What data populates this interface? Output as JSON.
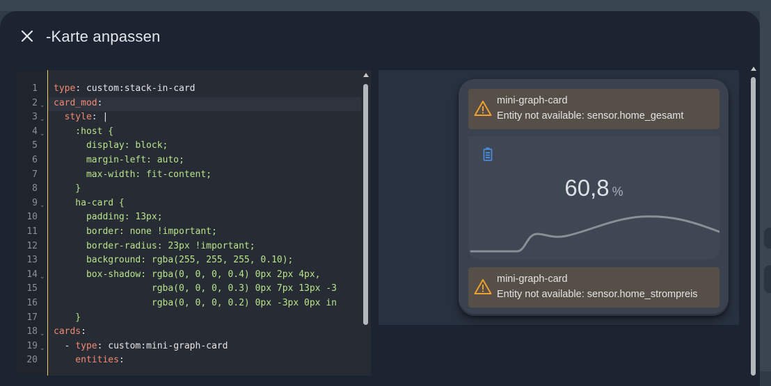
{
  "dialog": {
    "title": "-Karte anpassen"
  },
  "editor": {
    "lines": [
      {
        "n": "1",
        "fold": "",
        "parts": [
          [
            "k",
            "type"
          ],
          [
            "v",
            ": custom:stack-in-card"
          ]
        ]
      },
      {
        "n": "2",
        "fold": "⌄",
        "parts": [
          [
            "k",
            "card_mod"
          ],
          [
            "v",
            ":"
          ]
        ]
      },
      {
        "n": "3",
        "fold": "⌄",
        "parts": [
          [
            "v",
            "  "
          ],
          [
            "k",
            "style"
          ],
          [
            "v",
            ": |"
          ]
        ]
      },
      {
        "n": "4",
        "fold": "⌄",
        "parts": [
          [
            "s",
            "    :host {"
          ]
        ]
      },
      {
        "n": "5",
        "fold": "",
        "parts": [
          [
            "s",
            "      display: block;"
          ]
        ]
      },
      {
        "n": "6",
        "fold": "",
        "parts": [
          [
            "s",
            "      margin-left: auto;"
          ]
        ]
      },
      {
        "n": "7",
        "fold": "",
        "parts": [
          [
            "s",
            "      max-width: fit-content;"
          ]
        ]
      },
      {
        "n": "8",
        "fold": "",
        "parts": [
          [
            "s",
            "    }"
          ]
        ]
      },
      {
        "n": "9",
        "fold": "⌄",
        "parts": [
          [
            "s",
            "    ha-card {"
          ]
        ]
      },
      {
        "n": "10",
        "fold": "",
        "parts": [
          [
            "s",
            "      padding: 13px;"
          ]
        ]
      },
      {
        "n": "11",
        "fold": "",
        "parts": [
          [
            "s",
            "      border: none !important;"
          ]
        ]
      },
      {
        "n": "12",
        "fold": "",
        "parts": [
          [
            "s",
            "      border-radius: 23px !important;"
          ]
        ]
      },
      {
        "n": "13",
        "fold": "",
        "parts": [
          [
            "s",
            "      background: rgba(255, 255, 255, 0.10);"
          ]
        ]
      },
      {
        "n": "14",
        "fold": "⌄",
        "parts": [
          [
            "s",
            "      box-shadow: rgba(0, 0, 0, 0.4) 0px 2px 4px,"
          ]
        ]
      },
      {
        "n": "15",
        "fold": "",
        "parts": [
          [
            "s",
            "                  rgba(0, 0, 0, 0.3) 0px 7px 13px -3"
          ]
        ]
      },
      {
        "n": "16",
        "fold": "",
        "parts": [
          [
            "s",
            "                  rgba(0, 0, 0, 0.2) 0px -3px 0px in"
          ]
        ]
      },
      {
        "n": "17",
        "fold": "",
        "parts": [
          [
            "s",
            "    }"
          ]
        ]
      },
      {
        "n": "18",
        "fold": "⌄",
        "parts": [
          [
            "k",
            "cards"
          ],
          [
            "v",
            ":"
          ]
        ]
      },
      {
        "n": "19",
        "fold": "⌄",
        "parts": [
          [
            "v",
            "  - "
          ],
          [
            "k",
            "type"
          ],
          [
            "v",
            ": custom:mini-graph-card"
          ]
        ]
      },
      {
        "n": "20",
        "fold": "",
        "parts": [
          [
            "k",
            "    entities"
          ],
          [
            "v",
            ":"
          ]
        ]
      }
    ]
  },
  "preview": {
    "alert_top": {
      "title": "mini-graph-card",
      "message": "Entity not available: sensor.home_gesamt"
    },
    "graph": {
      "value": "60,8",
      "unit": "%",
      "icon": "battery-icon",
      "accent": "#4a8ad8",
      "line_color": "#8a8e95"
    },
    "alert_bottom": {
      "title": "mini-graph-card",
      "message": "Entity not available: sensor.home_strompreis"
    },
    "warning_color": "#f0a030"
  }
}
